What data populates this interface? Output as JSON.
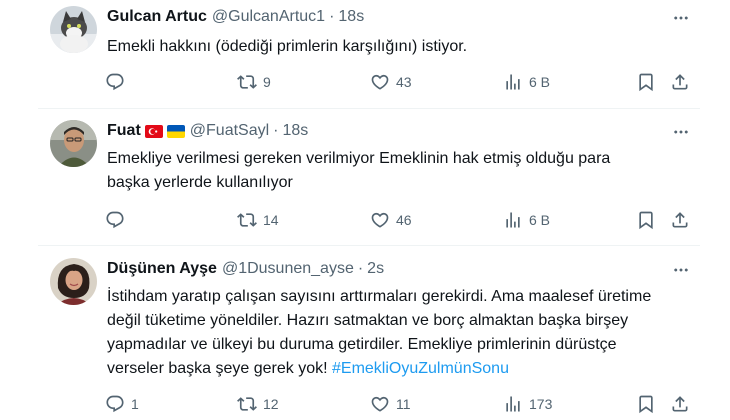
{
  "tweets": [
    {
      "name": "Gulcan Artuc",
      "handle": "@GulcanArtuc1",
      "separator": "·",
      "time": "18s",
      "text": "Emekli hakkını (ödediği primlerin karşılığını) istiyor.",
      "hashtag": "",
      "replies": "",
      "retweets": "9",
      "likes": "43",
      "views": "6 B"
    },
    {
      "name": "Fuat",
      "flags": [
        "turkey-flag",
        "ukraine-flag"
      ],
      "handle": "@FuatSayl",
      "separator": "·",
      "time": "18s",
      "text": "Emekliye verilmesi gereken verilmiyor Emeklinin hak etmiş olduğu para başka yerlerde kullanılıyor",
      "hashtag": "",
      "replies": "",
      "retweets": "14",
      "likes": "46",
      "views": "6 B"
    },
    {
      "name": "Düşünen Ayşe",
      "handle": "@1Dusunen_ayse",
      "separator": "·",
      "time": "2s",
      "text": "İstihdam yaratıp çalışan sayısını arttırmaları gerekirdi. Ama maalesef üretime değil tüketime yöneldiler. Hazırı satmaktan ve borç almaktan başka birşey yapmadılar ve ülkeyi bu duruma getirdiler. Emekliye primlerinin dürüstçe verseler başka şeye gerek yok! ",
      "hashtag": "#EmekliOyuZulmünSonu",
      "replies": "1",
      "retweets": "12",
      "likes": "11",
      "views": "173"
    }
  ],
  "colors": {
    "text": "#0f1419",
    "secondary": "#536471",
    "link": "#1d9bf0",
    "divider": "#eff3f4"
  },
  "icons": [
    "reply-icon",
    "retweet-icon",
    "like-icon",
    "views-icon",
    "bookmark-icon",
    "share-icon",
    "more-icon"
  ]
}
